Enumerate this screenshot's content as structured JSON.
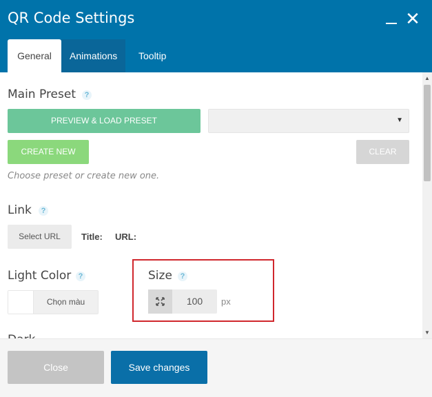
{
  "window": {
    "title": "QR Code Settings",
    "minimize_icon": "minimize-icon",
    "close_icon": "close-icon",
    "close_glyph": "✕"
  },
  "tabs": [
    {
      "label": "General",
      "active": true
    },
    {
      "label": "Animations",
      "active": false
    },
    {
      "label": "Tooltip",
      "active": false
    }
  ],
  "main_preset": {
    "label": "Main Preset",
    "help": "?",
    "preview_button": "Preview & Load Preset",
    "select_value": "",
    "select_arrow": "▼",
    "create_button": "CREATE NEW",
    "clear_button": "CLEAR",
    "hint": "Choose preset or create new one."
  },
  "link": {
    "label": "Link",
    "help": "?",
    "select_url_button": "Select URL",
    "title_label": "Title:",
    "url_label": "URL:"
  },
  "light_color": {
    "label": "Light Color",
    "help": "?",
    "picker_button": "Chọn màu",
    "swatch_color": "#ffffff"
  },
  "size": {
    "label": "Size",
    "help": "?",
    "value": "100",
    "unit": "px",
    "icon": "resize-icon"
  },
  "next_section_label_partial": "Dark",
  "footer": {
    "close_button": "Close",
    "save_button": "Save changes"
  },
  "colors": {
    "header": "#0073aa",
    "preview_button": "#6cc69a",
    "create_button": "#8bd87c",
    "save_button": "#0a6fa8",
    "highlight_border": "#d0262c"
  }
}
